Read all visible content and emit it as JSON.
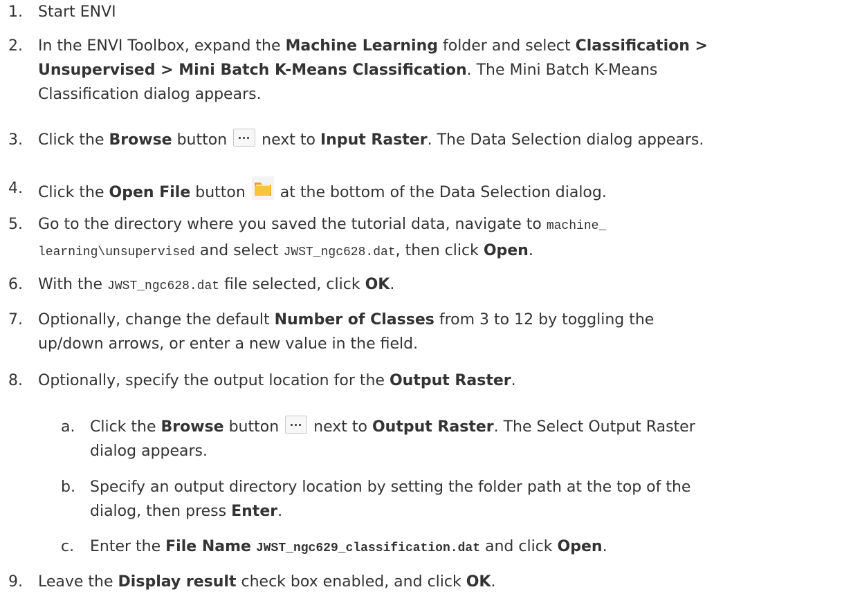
{
  "steps": [
    {
      "num": "1.",
      "text": "Start ENVI"
    },
    {
      "num": "2.",
      "t1": "In the ENVI Toolbox, expand the ",
      "b1": "Machine Learning",
      "t2": " folder and select ",
      "b2": "Classification >",
      "b3": "Unsupervised > Mini Batch K-Means Classification",
      "t3": ". The Mini Batch K-Means",
      "t4": "Classification dialog appears."
    },
    {
      "num": "3.",
      "t1": "Click the ",
      "b1": "Browse",
      "t2": " button ",
      "t3": " next to ",
      "b2": "Input Raster",
      "t4": ". The Data Selection dialog appears."
    },
    {
      "num": "4.",
      "t1": "Click the ",
      "b1": "Open File",
      "t2": " button ",
      "t3": " at the bottom of the Data Selection dialog."
    },
    {
      "num": "5.",
      "t1": "Go to the directory where you saved the tutorial data, navigate to ",
      "c1": "machine_",
      "c2": "learning\\unsupervised",
      "t2": " and select ",
      "c3": "JWST_ngc628.dat",
      "t3": ", then click ",
      "b1": "Open",
      "t4": "."
    },
    {
      "num": "6.",
      "t1": "With the ",
      "c1": "JWST_ngc628.dat",
      "t2": " file selected, click ",
      "b1": "OK",
      "t3": "."
    },
    {
      "num": "7.",
      "t1": "Optionally, change the default ",
      "b1": "Number of Classes",
      "t2": " from 3 to 12 by toggling the",
      "t3": "up/down arrows, or enter a new value in the field."
    },
    {
      "num": "8.",
      "t1": "Optionally, specify the output location for the ",
      "b1": "Output Raster",
      "t2": "."
    },
    {
      "num": "a.",
      "t1": "Click the ",
      "b1": "Browse",
      "t2": " button ",
      "t3": " next to ",
      "b2": "Output Raster",
      "t4": ". The Select Output Raster",
      "t5": "dialog appears."
    },
    {
      "num": "b.",
      "t1": "Specify an output directory location by setting the folder path at the top of the",
      "t2": "dialog, then press ",
      "b1": "Enter",
      "t3": "."
    },
    {
      "num": "c.",
      "t1": "Enter the ",
      "b1": "File Name",
      "t2": " ",
      "c1": "JWST_ngc629_classification.dat",
      "t3": " and click ",
      "b2": "Open",
      "t4": "."
    },
    {
      "num": "9.",
      "t1": "Leave the ",
      "b1": "Display result",
      "t2": " check box enabled, and click ",
      "b2": "OK",
      "t3": "."
    }
  ],
  "icons": {
    "browse": "ellipsis-button-icon",
    "open_file": "folder-icon",
    "folder_color": "#f5b828"
  }
}
